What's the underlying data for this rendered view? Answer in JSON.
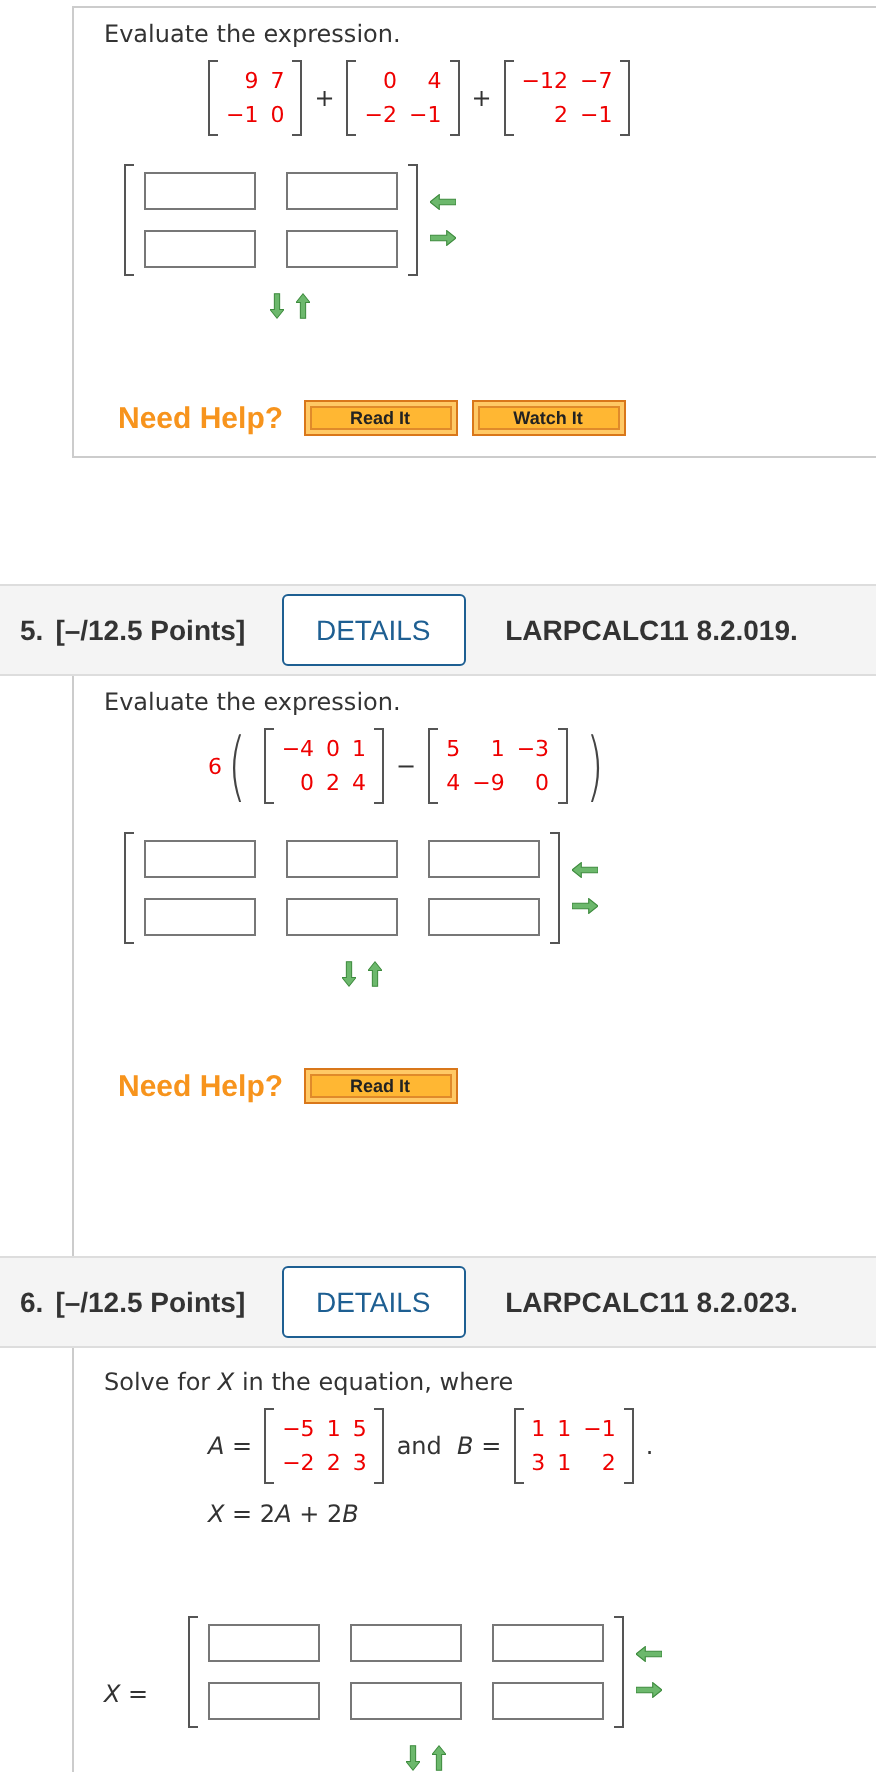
{
  "problems": [
    {
      "prompt": "Evaluate the expression.",
      "lines": [
        {
          "tokens": [
            {
              "kind": "matrix",
              "rows": [
                [
                  "9",
                  "7"
                ],
                [
                  "−1",
                  "0"
                ]
              ]
            },
            {
              "kind": "op",
              "text": "+"
            },
            {
              "kind": "matrix",
              "rows": [
                [
                  "0",
                  "4"
                ],
                [
                  "−2",
                  "−1"
                ]
              ]
            },
            {
              "kind": "op",
              "text": "+"
            },
            {
              "kind": "matrix",
              "rows": [
                [
                  "−12",
                  "−7"
                ],
                [
                  "2",
                  "−1"
                ]
              ]
            }
          ]
        }
      ],
      "answer": {
        "rows": [
          {
            "cells": [
              {
                "kind": "input"
              },
              {
                "kind": "input"
              }
            ]
          },
          {
            "cells": [
              {
                "kind": "input"
              },
              {
                "kind": "input"
              }
            ]
          }
        ]
      },
      "help": {
        "label": "Need Help?",
        "buttons": [
          "Read It",
          "Watch It"
        ]
      }
    },
    {
      "number": "5.",
      "points": "[–/12.5 Points]",
      "details": "DETAILS",
      "code": "LARPCALC11 8.2.019.",
      "prompt": "Evaluate the expression.",
      "lines": [
        {
          "tokens": [
            {
              "kind": "scalar",
              "text": "6"
            },
            {
              "kind": "paren",
              "text": "("
            },
            {
              "kind": "matrix",
              "rows": [
                [
                  "−4",
                  "0",
                  "1"
                ],
                [
                  "0",
                  "2",
                  "4"
                ]
              ]
            },
            {
              "kind": "op",
              "text": "−"
            },
            {
              "kind": "matrix",
              "rows": [
                [
                  "5",
                  "1",
                  "−3"
                ],
                [
                  "4",
                  "−9",
                  "0"
                ]
              ]
            },
            {
              "kind": "paren",
              "text": ")"
            }
          ]
        }
      ],
      "answer": {
        "rows": [
          {
            "cells": [
              {
                "kind": "input"
              },
              {
                "kind": "input"
              },
              {
                "kind": "input"
              }
            ]
          },
          {
            "cells": [
              {
                "kind": "input"
              },
              {
                "kind": "input"
              },
              {
                "kind": "input"
              }
            ]
          }
        ]
      },
      "help": {
        "label": "Need Help?",
        "buttons": [
          "Read It"
        ]
      }
    },
    {
      "number": "6.",
      "points": "[–/12.5 Points]",
      "details": "DETAILS",
      "code": "LARPCALC11 8.2.023.",
      "prompt": "Solve for *X* in the equation, where",
      "lines": [
        {
          "tokens": [
            {
              "kind": "text",
              "text": "*A* ="
            },
            {
              "kind": "matrix",
              "rows": [
                [
                  "−5",
                  "1",
                  "5"
                ],
                [
                  "−2",
                  "2",
                  "3"
                ]
              ]
            },
            {
              "kind": "text",
              "text": "and  *B* ="
            },
            {
              "kind": "matrix",
              "rows": [
                [
                  "1",
                  "1",
                  "−1"
                ],
                [
                  "3",
                  "1",
                  "2"
                ]
              ]
            },
            {
              "kind": "text",
              "text": "."
            }
          ]
        },
        {
          "tokens": [
            {
              "kind": "math",
              "parts": [
                "*X* = 2",
                "*A*",
                " + 2",
                "*B*"
              ]
            }
          ]
        }
      ],
      "answer": {
        "label": "*X* =",
        "rows": [
          {
            "cells": [
              {
                "kind": "input"
              },
              {
                "kind": "input"
              },
              {
                "kind": "input"
              }
            ]
          },
          {
            "cells": [
              {
                "kind": "input"
              },
              {
                "kind": "input"
              },
              {
                "kind": "input"
              }
            ]
          }
        ]
      }
    }
  ]
}
